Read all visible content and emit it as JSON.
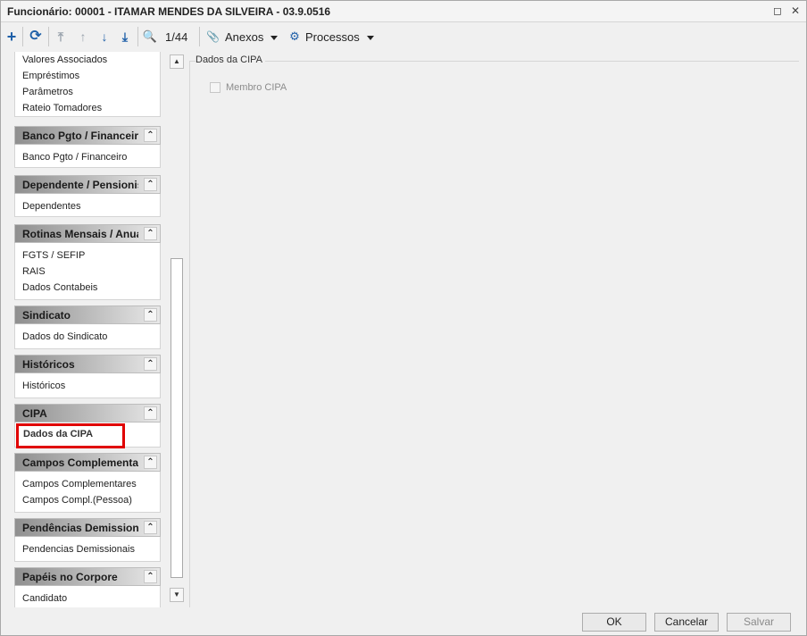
{
  "window": {
    "title": "Funcionário: 00001 - ITAMAR MENDES DA SILVEIRA - 03.9.0516",
    "restore_glyph": "◻",
    "close_glyph": "✕"
  },
  "toolbar": {
    "add_glyph": "+",
    "refresh_glyph": "⟳",
    "first_glyph": "⤒",
    "prev_glyph": "↑",
    "next_glyph": "↓",
    "last_glyph": "⤓",
    "search_glyph": "🔍",
    "record_counter": "1/44",
    "attachments_glyph": "📎",
    "attachments_label": "Anexos",
    "processes_glyph": "⚙",
    "processes_label": "Processos"
  },
  "nav": {
    "top_items": [
      "Valores Associados",
      "Empréstimos",
      "Parâmetros",
      "Rateio Tomadores"
    ],
    "collapse_glyph": "⌃",
    "groups": [
      {
        "title": "Banco Pgto / Financeiro",
        "items": [
          "Banco Pgto / Financeiro"
        ]
      },
      {
        "title": "Dependente / Pensionistas",
        "items": [
          "Dependentes"
        ]
      },
      {
        "title": "Rotinas Mensais / Anuais",
        "items": [
          "FGTS / SEFIP",
          "RAIS",
          "Dados Contabeis"
        ]
      },
      {
        "title": "Sindicato",
        "items": [
          "Dados do Sindicato"
        ]
      },
      {
        "title": "Históricos",
        "items": [
          "Históricos"
        ]
      },
      {
        "title": "CIPA",
        "items": [
          "Dados da CIPA"
        ]
      },
      {
        "title": "Campos Complementares",
        "items": [
          "Campos Complementares",
          "Campos Compl.(Pessoa)"
        ]
      },
      {
        "title": "Pendências Demissionais",
        "items": [
          "Pendencias Demissionais"
        ]
      },
      {
        "title": "Papéis no Corpore",
        "items": [
          "Candidato"
        ]
      }
    ]
  },
  "scrollbar": {
    "up_glyph": "▲",
    "down_glyph": "▼"
  },
  "content": {
    "section_title": "Dados da CIPA",
    "member_label": "Membro CIPA",
    "member_checked": false
  },
  "footer": {
    "ok_label": "OK",
    "cancel_label": "Cancelar",
    "save_label": "Salvar"
  }
}
